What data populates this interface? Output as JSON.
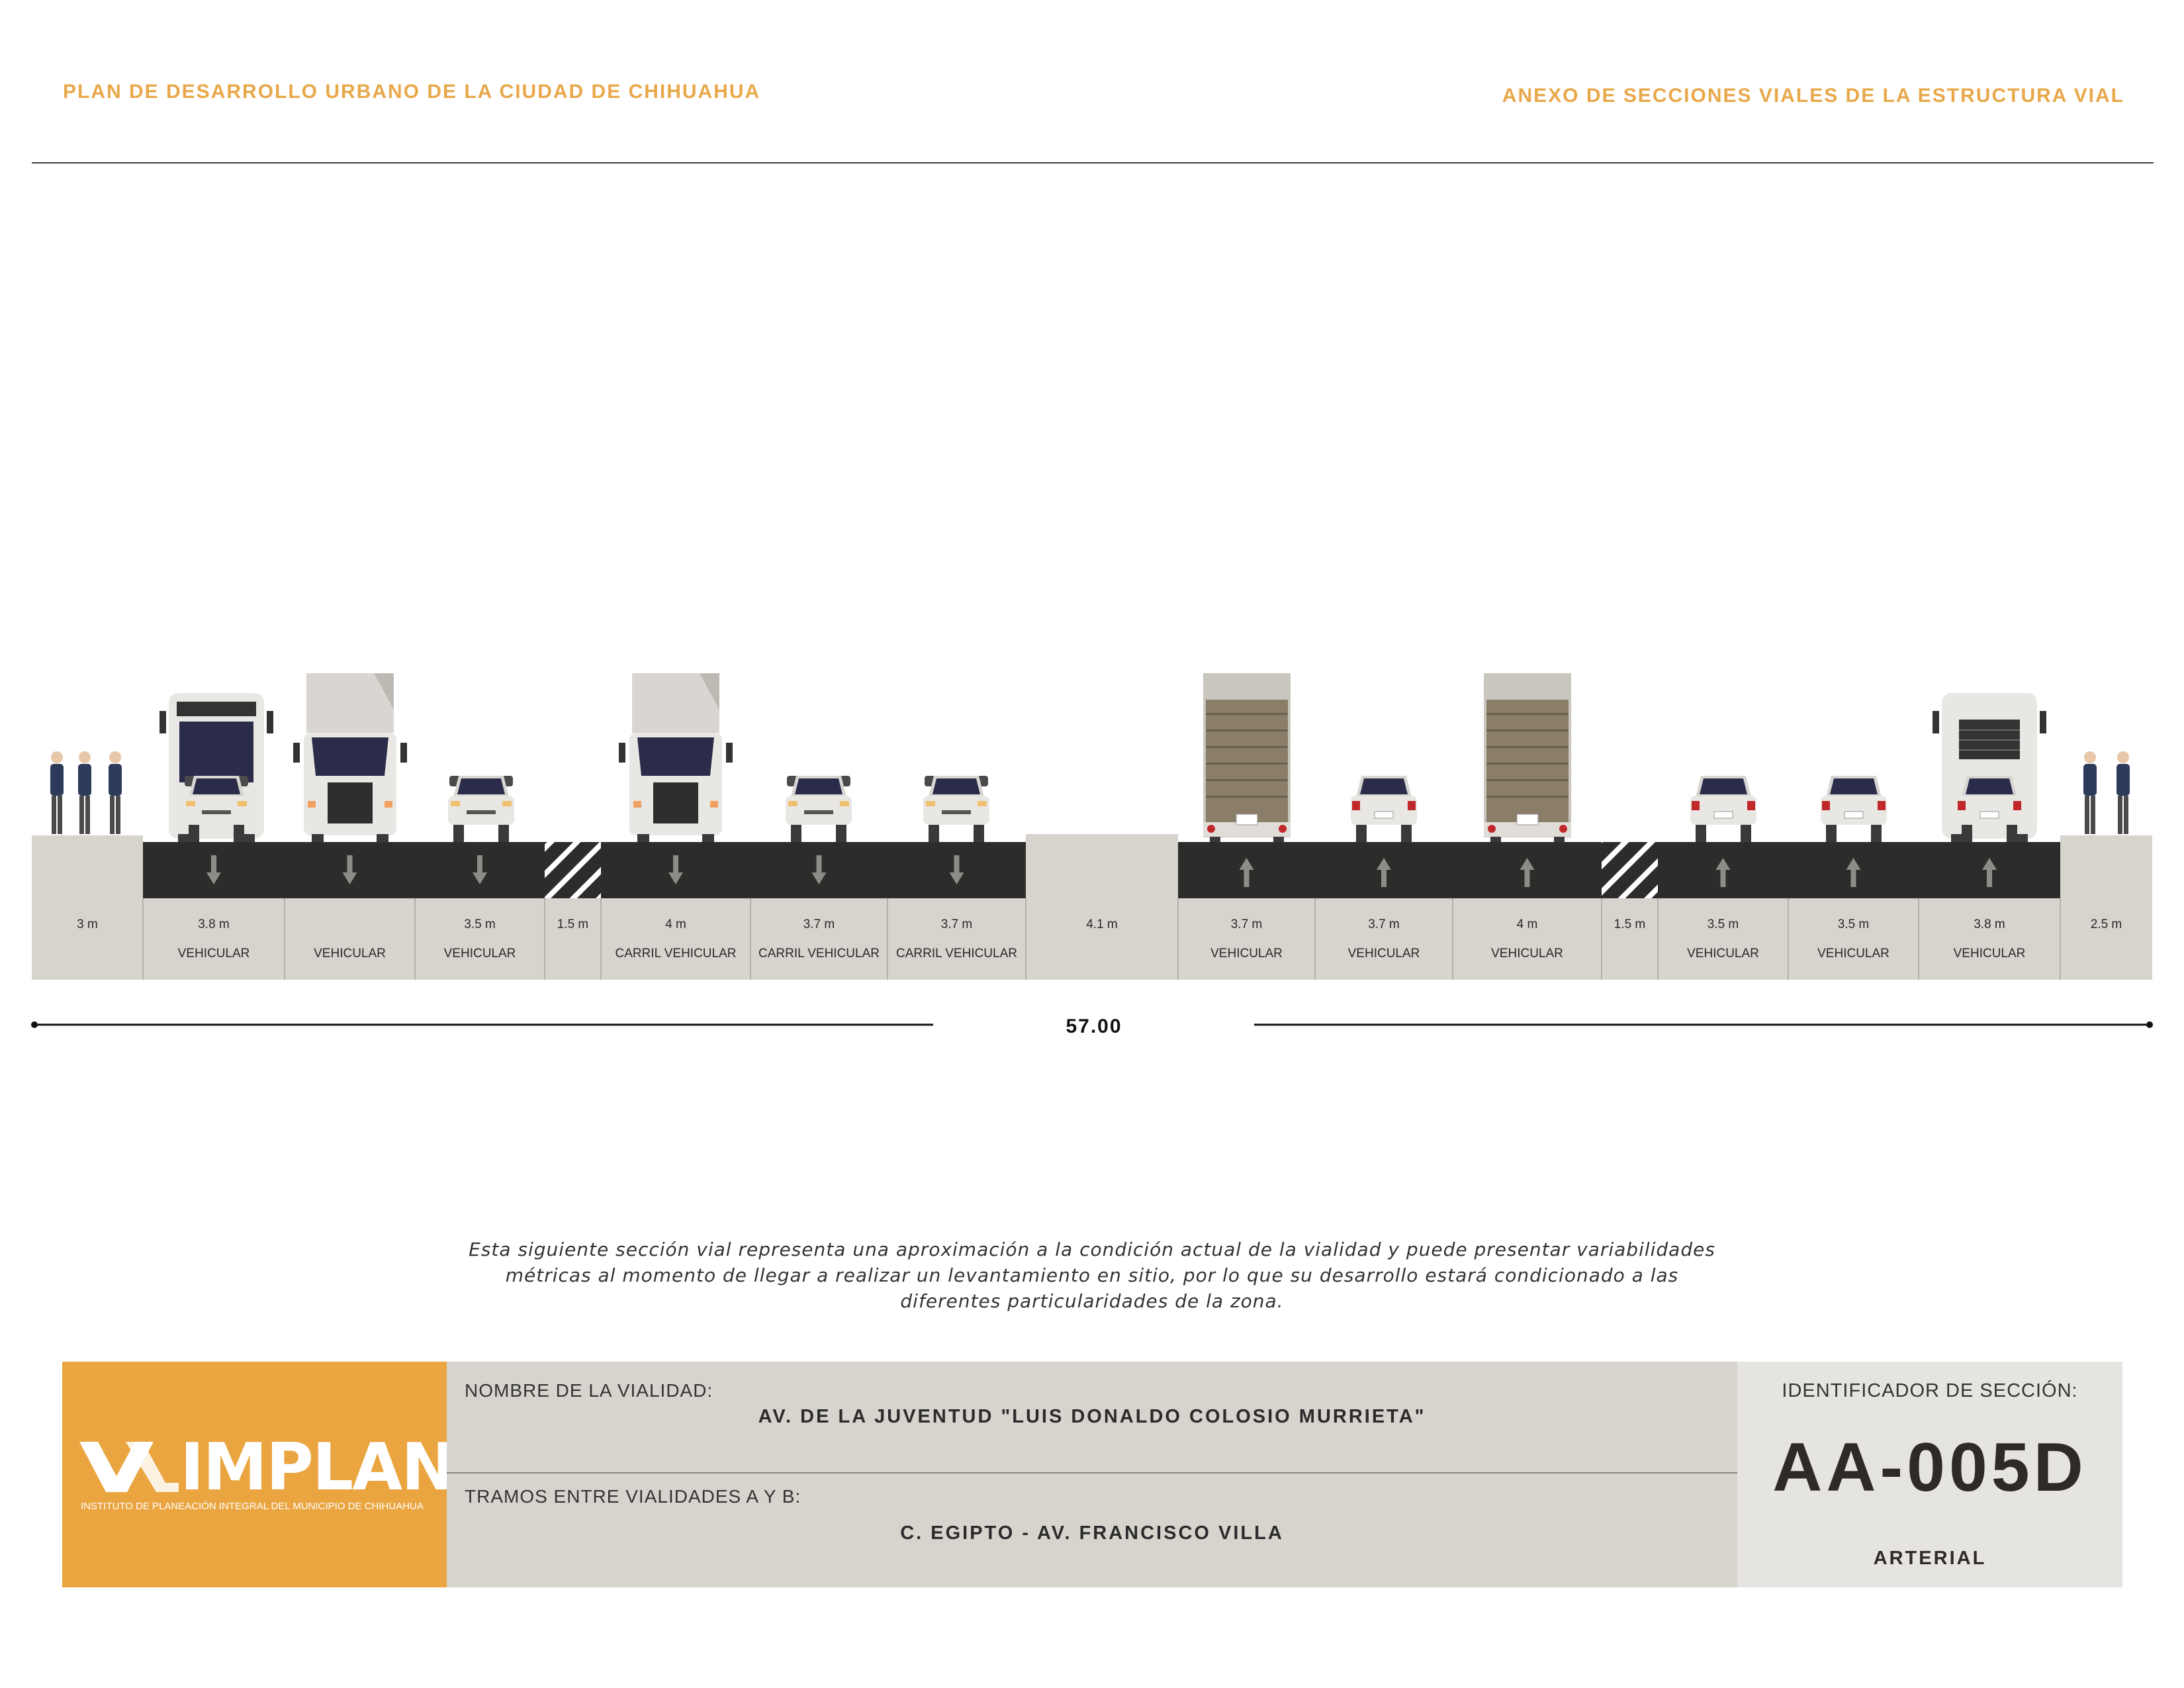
{
  "header": {
    "left": "PLAN DE DESARROLLO URBANO DE LA CIUDAD DE CHIHUAHUA",
    "right": "ANEXO DE SECCIONES VIALES DE LA ESTRUCTURA VIAL"
  },
  "section": {
    "total_width": "57.00",
    "segments": [
      {
        "width": "3 m",
        "label": "",
        "kind": "sidewalk"
      },
      {
        "width": "3.8 m",
        "label": "VEHICULAR",
        "kind": "lane",
        "direction": "down"
      },
      {
        "width": "",
        "label": "VEHICULAR",
        "kind": "lane",
        "direction": "down"
      },
      {
        "width": "3.5 m",
        "label": "VEHICULAR",
        "kind": "lane",
        "direction": "down"
      },
      {
        "width": "1.5 m",
        "label": "",
        "kind": "buffer"
      },
      {
        "width": "4 m",
        "label": "CARRIL VEHICULAR",
        "kind": "lane",
        "direction": "down"
      },
      {
        "width": "3.7 m",
        "label": "CARRIL VEHICULAR",
        "kind": "lane",
        "direction": "down"
      },
      {
        "width": "3.7 m",
        "label": "CARRIL VEHICULAR",
        "kind": "lane",
        "direction": "down"
      },
      {
        "width": "4.1 m",
        "label": "",
        "kind": "median"
      },
      {
        "width": "3.7 m",
        "label": "VEHICULAR",
        "kind": "lane",
        "direction": "up"
      },
      {
        "width": "3.7 m",
        "label": "VEHICULAR",
        "kind": "lane",
        "direction": "up"
      },
      {
        "width": "4 m",
        "label": "VEHICULAR",
        "kind": "lane",
        "direction": "up"
      },
      {
        "width": "1.5 m",
        "label": "",
        "kind": "buffer"
      },
      {
        "width": "3.5 m",
        "label": "VEHICULAR",
        "kind": "lane",
        "direction": "up"
      },
      {
        "width": "3.5 m",
        "label": "VEHICULAR",
        "kind": "lane",
        "direction": "up"
      },
      {
        "width": "3.8 m",
        "label": "VEHICULAR",
        "kind": "lane",
        "direction": "up"
      },
      {
        "width": "2.5 m",
        "label": "",
        "kind": "sidewalk"
      }
    ]
  },
  "note": "Esta siguiente sección vial representa una aproximación a la condición actual de la vialidad y puede presentar variabilidades métricas al momento de llegar a realizar un levantamiento en sitio, por lo que su desarrollo estará condicionado a las diferentes particularidades de la zona.",
  "info": {
    "name_label": "NOMBRE DE LA VIALIDAD:",
    "name_value": "AV. DE LA JUVENTUD \"LUIS DONALDO COLOSIO MURRIETA\"",
    "stretch_label": "TRAMOS ENTRE VIALIDADES A Y B:",
    "stretch_value": "C. EGIPTO - AV. FRANCISCO VILLA"
  },
  "identifier": {
    "label": "IDENTIFICADOR DE SECCIÓN:",
    "code": "AA-005D",
    "type": "ARTERIAL"
  },
  "logo": {
    "name": "IMPLAN",
    "subtitle": "INSTITUTO DE PLANEACIÓN INTEGRAL DEL MUNICIPIO DE CHIHUAHUA"
  },
  "colors": {
    "accent": "#E8A84A",
    "asphalt": "#2C2D2B",
    "sidewalk": "#D7D3CD",
    "logo_bg": "#EAA540"
  }
}
